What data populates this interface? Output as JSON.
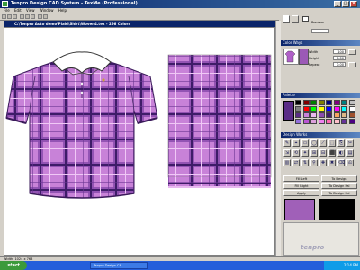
{
  "app": {
    "title": "Tenpro Design CAD System - TexMe (Professional)",
    "document_title": "C:\\Tenpro Auto demo\\Plaid\\Shirt\\Woven4.tex - 256 Colors"
  },
  "menu": [
    "File",
    "Edit",
    "View",
    "Window",
    "Help"
  ],
  "right_panel": {
    "preview_label": "Preview",
    "colorway_title": "Color Ways",
    "fields": [
      {
        "label": "Width",
        "value": "100"
      },
      {
        "label": "Height",
        "value": "0.00"
      },
      {
        "label": "Repeat",
        "value": "0.00"
      }
    ],
    "palette_title": "Palette",
    "tools_title": "Design Works",
    "buttons": [
      "Fill Left",
      "To Design",
      "Fill Right",
      "To Design Pal",
      "Apply",
      "To Design Pal"
    ]
  },
  "status": {
    "left": "Width: 1024  x  768"
  },
  "taskbar": {
    "start": "start",
    "tasks": [
      "Tenpro Design CA..."
    ],
    "clock": "2:14 PM"
  },
  "watermark": "tenpro",
  "colors": {
    "plaid_base": "#c882d8",
    "plaid_dark": "#5a2c86",
    "plaid_light": "#e8b8f0",
    "accent": "#0a246a"
  }
}
